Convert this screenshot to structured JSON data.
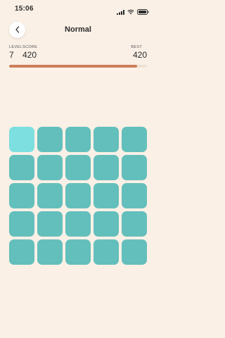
{
  "status_bar": {
    "time": "15:06",
    "icons": [
      "signal-icon",
      "wifi-icon",
      "battery-icon"
    ]
  },
  "header": {
    "back_icon": "chevron-left-icon",
    "title": "Normal"
  },
  "stats": {
    "level_label": "LEVEL",
    "level_value": "7",
    "score_label": "SCORE",
    "score_value": "420",
    "best_label": "BEST",
    "best_value": "420"
  },
  "progress": {
    "fraction": 0.93,
    "color": "#cc7e5c"
  },
  "board": {
    "rows": 5,
    "cols": 5,
    "tile_color": "#63bfbb",
    "highlight_color": "#7ddfe0",
    "highlighted": [
      [
        0,
        0
      ]
    ]
  },
  "colors": {
    "background": "#faf0e6"
  }
}
